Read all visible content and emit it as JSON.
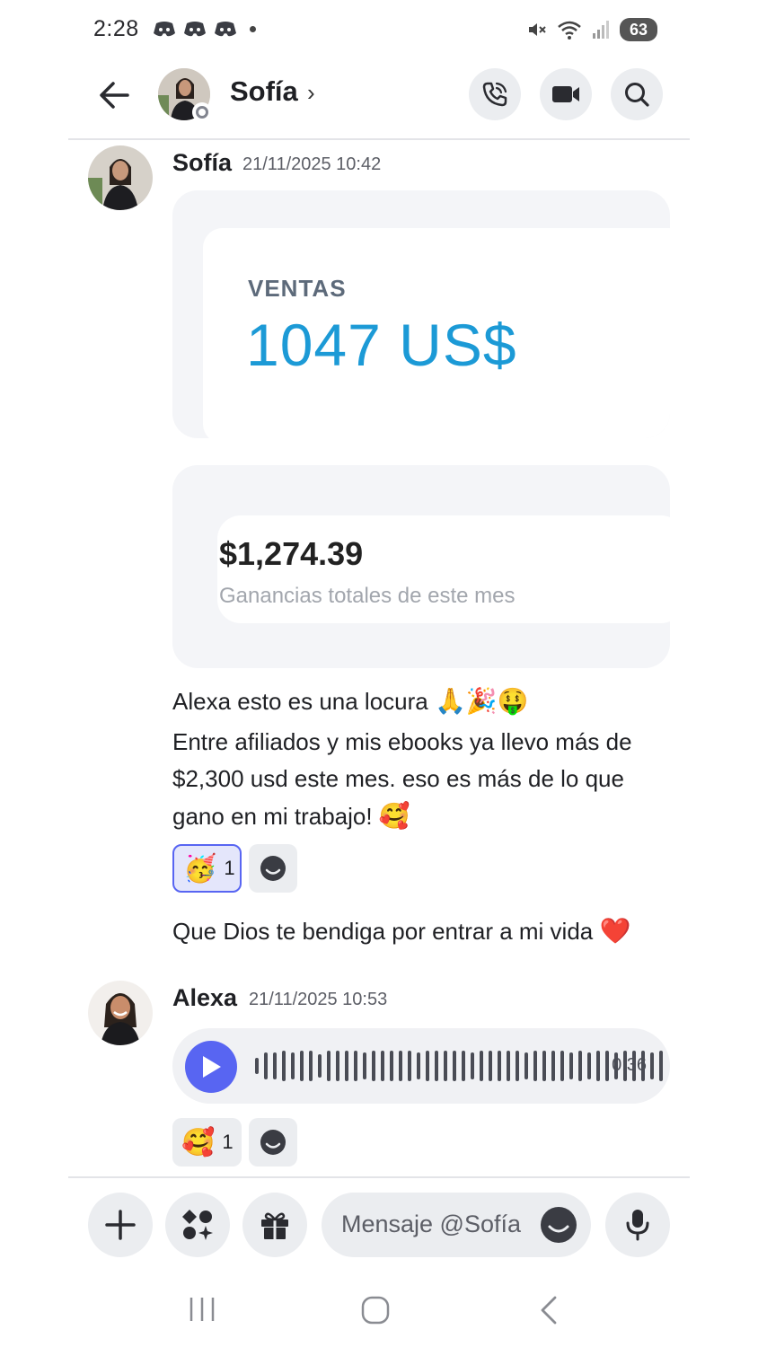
{
  "status_bar": {
    "time": "2:28",
    "notification_icons": [
      "discord-icon",
      "discord-icon",
      "discord-icon"
    ],
    "battery": "63"
  },
  "header": {
    "contact_name": "Sofía",
    "chevron": "›",
    "buttons": [
      "voice-call-icon",
      "video-call-icon",
      "search-icon"
    ]
  },
  "messages": [
    {
      "author": "Sofía",
      "timestamp": "21/11/2025 10:42",
      "attachments": [
        {
          "label": "VENTAS",
          "value": "1047 US$"
        },
        {
          "value": "$1,274.39",
          "label": "Ganancias totales de este mes"
        }
      ],
      "line1": "Alexa esto es una locura",
      "line1_emojis": "🙏🎉🤑",
      "line2": "Entre afiliados y mis ebooks ya llevo más de $2,300 usd este mes. eso es más de lo que gano en mi trabajo!",
      "line2_emoji": "🥰",
      "reaction": {
        "emoji": "🥳",
        "count": "1"
      },
      "line3": "Que Dios te bendiga por entrar a mi vida",
      "line3_emoji": "❤️"
    },
    {
      "author": "Alexa",
      "timestamp": "21/11/2025 10:53",
      "voice_duration": "0:36",
      "reaction": {
        "emoji": "🥰",
        "count": "1"
      }
    }
  ],
  "composer": {
    "placeholder": "Mensaje @Sofía",
    "buttons": [
      "plus-icon",
      "apps-icon",
      "gift-icon",
      "emoji-icon",
      "microphone-icon"
    ]
  },
  "colors": {
    "accent": "#5865f2",
    "ventas_blue": "#1c9ad6",
    "heart": "#e3243b"
  }
}
